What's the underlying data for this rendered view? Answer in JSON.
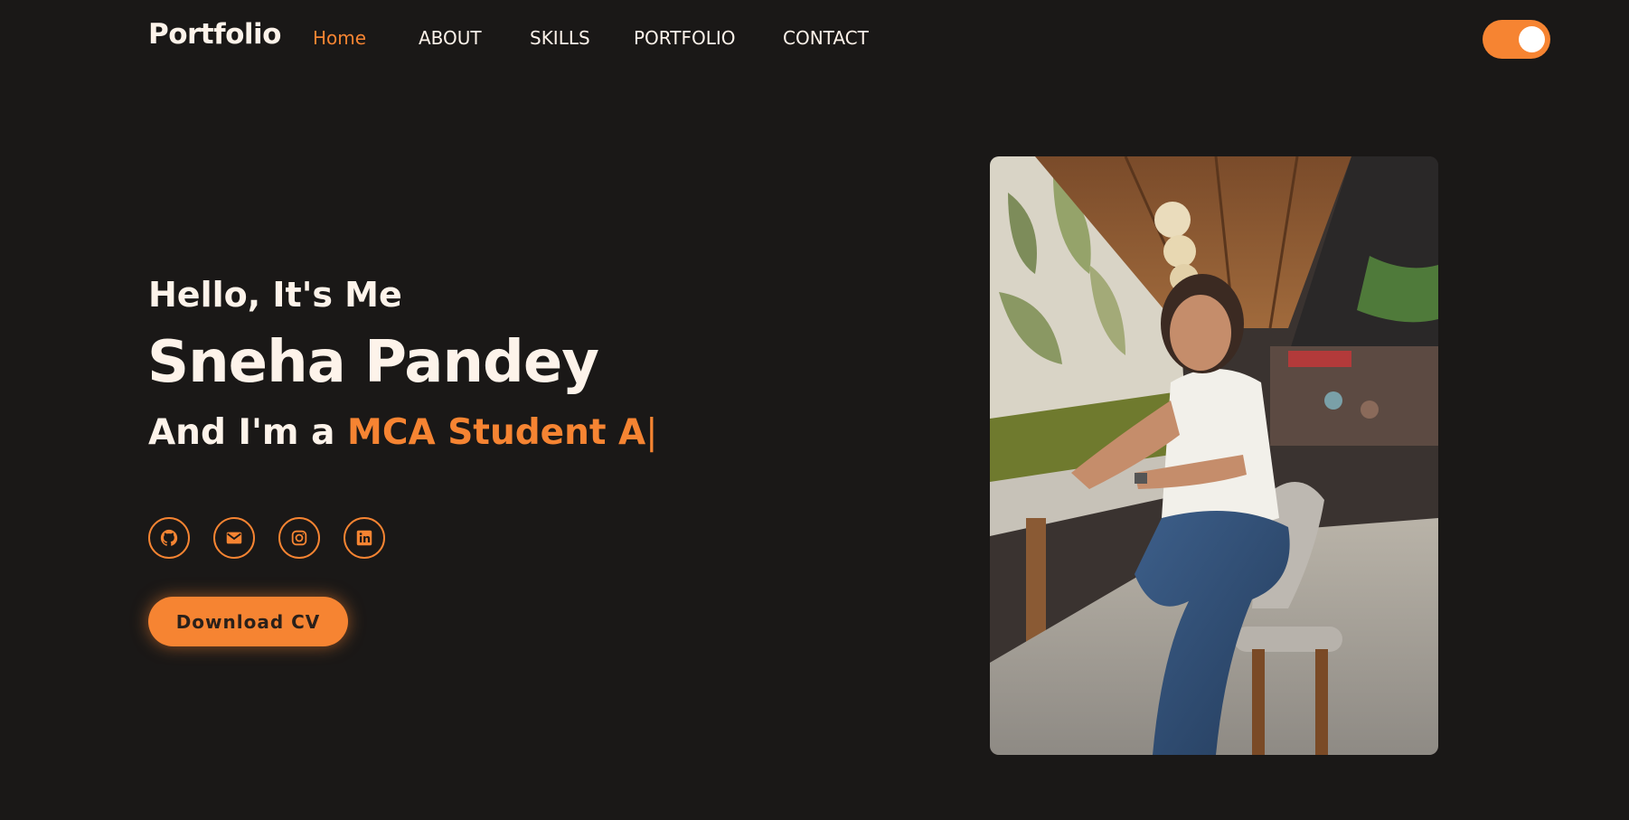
{
  "header": {
    "logo": "Portfolio",
    "nav": [
      {
        "label": "Home",
        "active": true
      },
      {
        "label": "ABOUT",
        "active": false
      },
      {
        "label": "SKILLS",
        "active": false
      },
      {
        "label": "PORTFOLIO",
        "active": false
      },
      {
        "label": "CONTACT",
        "active": false
      }
    ],
    "theme_toggle": {
      "on": true
    }
  },
  "hero": {
    "greeting": "Hello, It's Me",
    "name": "Sneha Pandey",
    "role_prefix": "And I'm a ",
    "role_typed": "MCA Student A",
    "cursor": "|",
    "social": [
      {
        "icon": "github-icon"
      },
      {
        "icon": "mail-icon"
      },
      {
        "icon": "instagram-icon"
      },
      {
        "icon": "linkedin-icon"
      }
    ],
    "cta_label": "Download CV"
  },
  "colors": {
    "background": "#1a1817",
    "accent": "#f68432",
    "text": "#fdf3ea"
  }
}
